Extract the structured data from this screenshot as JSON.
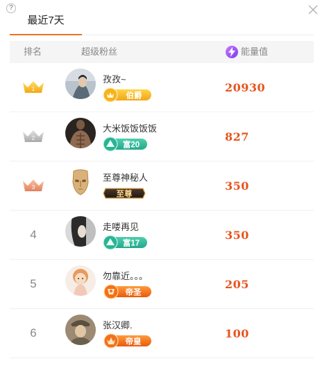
{
  "header": {
    "help_icon": "help-circle-icon",
    "close_icon": "close-icon",
    "tab_label": "最近7天",
    "accent_color": "#f0701e"
  },
  "table": {
    "col_rank": "排名",
    "col_fans": "超级粉丝",
    "col_energy": "能量值",
    "energy_icon": "lightning-icon"
  },
  "rows": [
    {
      "rank": "1",
      "rank_icon": "gold-crown-icon",
      "name": "孜孜~",
      "badge": {
        "type": "noble",
        "label": "伯爵"
      },
      "energy": "20930"
    },
    {
      "rank": "2",
      "rank_icon": "silver-crown-icon",
      "name": "大米饭饭饭饭",
      "badge": {
        "type": "wealth",
        "label": "富20"
      },
      "energy": "827"
    },
    {
      "rank": "3",
      "rank_icon": "bronze-crown-icon",
      "name": "至尊神秘人",
      "badge": {
        "type": "supreme",
        "label": "至尊"
      },
      "energy": "350"
    },
    {
      "rank": "4",
      "name": "走喽再见",
      "badge": {
        "type": "wealth",
        "label": "富17"
      },
      "energy": "350"
    },
    {
      "rank": "5",
      "name": "勿靠近。。。",
      "badge": {
        "type": "emperor",
        "label": "帝圣"
      },
      "energy": "205"
    },
    {
      "rank": "6",
      "name": "张汉卿.",
      "badge": {
        "type": "emperor",
        "label": "帝皇"
      },
      "energy": "100"
    }
  ]
}
